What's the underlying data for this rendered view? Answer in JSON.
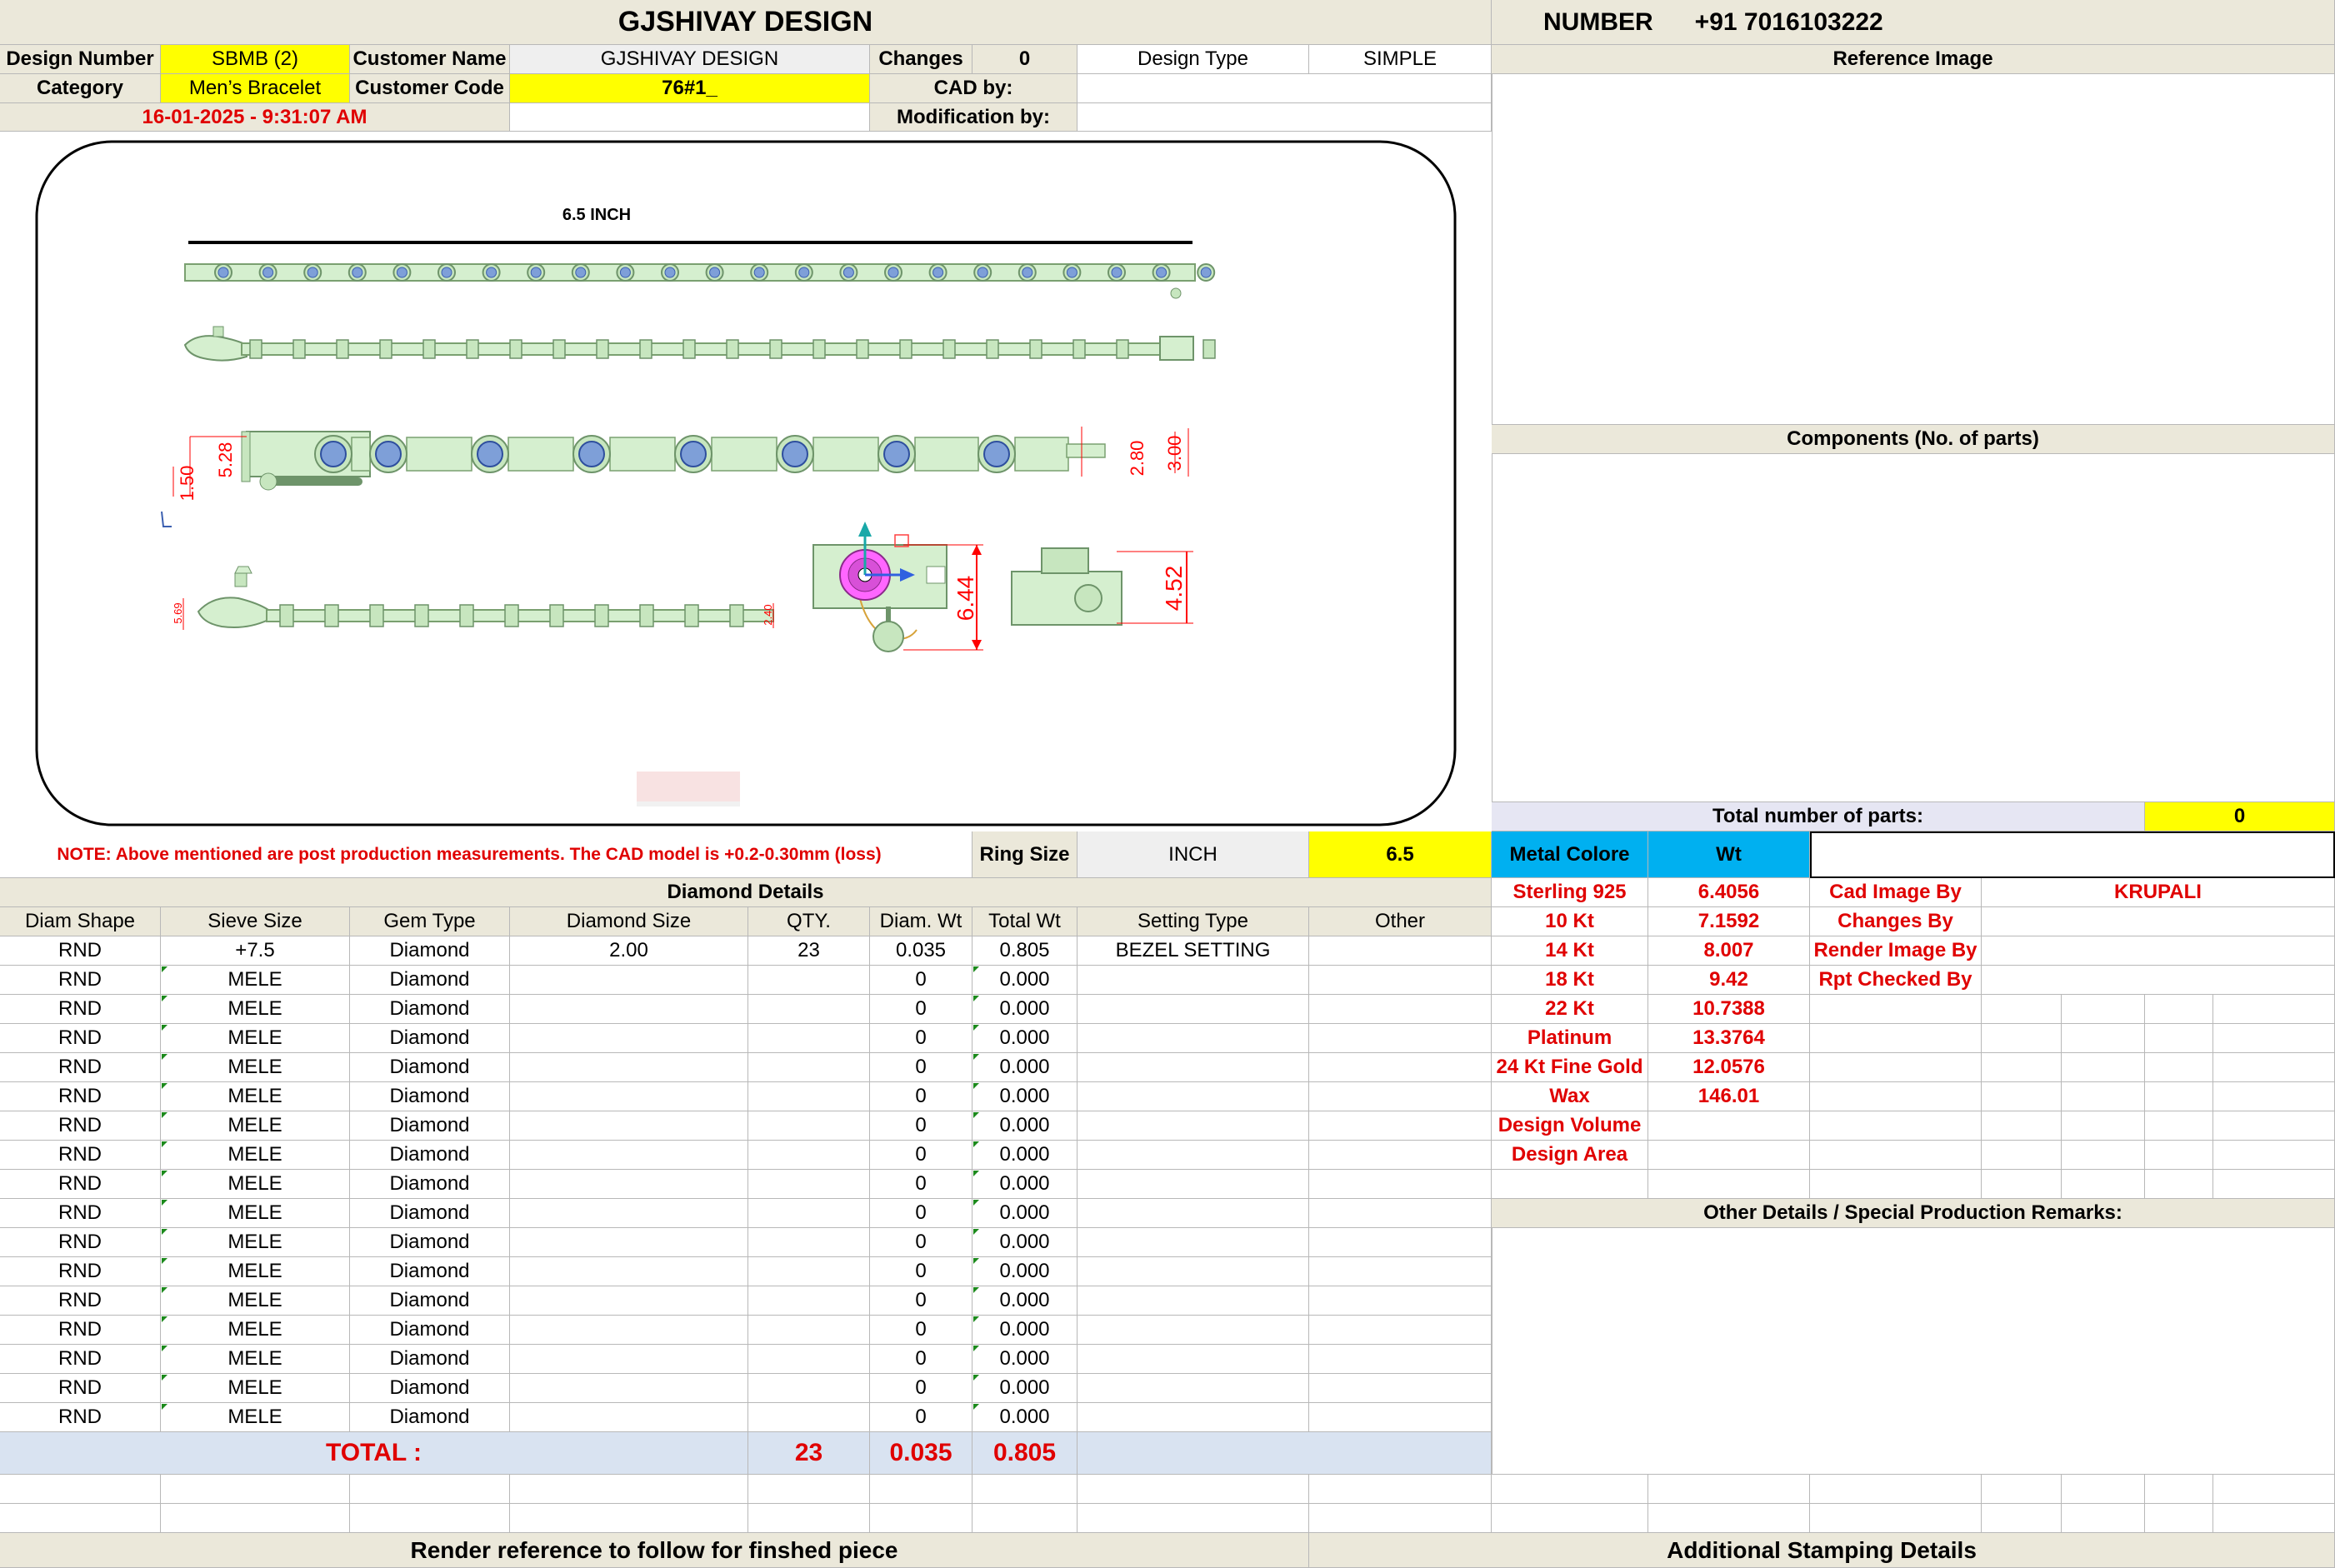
{
  "header": {
    "company": "GJSHIVAY DESIGN",
    "number_label": "NUMBER",
    "number_value": "+91 7016103222"
  },
  "info": {
    "design_number_label": "Design Number",
    "design_number": "SBMB (2)",
    "customer_name_label": "Customer Name",
    "customer_name": "GJSHIVAY DESIGN",
    "changes_label": "Changes",
    "changes": "0",
    "design_type_label": "Design Type",
    "design_type": "SIMPLE",
    "category_label": "Category",
    "category": "Men’s Bracelet",
    "customer_code_label": "Customer Code",
    "customer_code": "76#1_",
    "cad_by_label": "CAD by:",
    "cad_by": "",
    "timestamp": "16-01-2025 - 9:31:07 AM",
    "modification_by_label": "Modification by:",
    "modification_by": ""
  },
  "drawing": {
    "length_label": "6.5 INCH",
    "dims": {
      "d1": "1.50",
      "d2": "5.28",
      "d3": "2.80",
      "d4": "3.00",
      "d5": "5.69",
      "d6": "2.40",
      "d7": "6.44",
      "d8": "4.52"
    }
  },
  "right_panel": {
    "reference_image_label": "Reference Image",
    "components_label": "Components (No. of parts)",
    "total_parts_label": "Total number of parts:",
    "total_parts": "0",
    "other_details_label": "Other Details / Special Production Remarks:"
  },
  "note": "NOTE: Above mentioned are post production measurements. The CAD model is +0.2-0.30mm (loss)",
  "ring": {
    "label": "Ring Size",
    "unit": "INCH",
    "value": "6.5"
  },
  "metal": {
    "color_label": "Metal Colore",
    "wt_label": "Wt",
    "rows": [
      {
        "name": "Sterling 925",
        "wt": "6.4056"
      },
      {
        "name": "10 Kt",
        "wt": "7.1592"
      },
      {
        "name": "14 Kt",
        "wt": "8.007"
      },
      {
        "name": "18 Kt",
        "wt": "9.42"
      },
      {
        "name": "22 Kt",
        "wt": "10.7388"
      },
      {
        "name": "Platinum",
        "wt": "13.3764"
      },
      {
        "name": "24 Kt Fine Gold",
        "wt": "12.0576"
      },
      {
        "name": "Wax",
        "wt": "146.01"
      },
      {
        "name": "Design Volume",
        "wt": ""
      },
      {
        "name": "Design Area",
        "wt": ""
      }
    ]
  },
  "credits": [
    {
      "label": "Cad Image By",
      "value": "KRUPALI"
    },
    {
      "label": "Changes By",
      "value": ""
    },
    {
      "label": "Render Image By",
      "value": ""
    },
    {
      "label": "Rpt Checked By",
      "value": ""
    }
  ],
  "diamond": {
    "title": "Diamond Details",
    "columns": [
      "Diam Shape",
      "Sieve Size",
      "Gem Type",
      "Diamond Size",
      "QTY.",
      "Diam. Wt",
      "Total Wt",
      "Setting Type",
      "Other"
    ],
    "rows": [
      [
        "RND",
        "+7.5",
        "Diamond",
        "2.00",
        "23",
        "0.035",
        "0.805",
        "BEZEL SETTING",
        ""
      ],
      [
        "RND",
        "MELE",
        "Diamond",
        "",
        "",
        "0",
        "0.000",
        "",
        ""
      ],
      [
        "RND",
        "MELE",
        "Diamond",
        "",
        "",
        "0",
        "0.000",
        "",
        ""
      ],
      [
        "RND",
        "MELE",
        "Diamond",
        "",
        "",
        "0",
        "0.000",
        "",
        ""
      ],
      [
        "RND",
        "MELE",
        "Diamond",
        "",
        "",
        "0",
        "0.000",
        "",
        ""
      ],
      [
        "RND",
        "MELE",
        "Diamond",
        "",
        "",
        "0",
        "0.000",
        "",
        ""
      ],
      [
        "RND",
        "MELE",
        "Diamond",
        "",
        "",
        "0",
        "0.000",
        "",
        ""
      ],
      [
        "RND",
        "MELE",
        "Diamond",
        "",
        "",
        "0",
        "0.000",
        "",
        ""
      ],
      [
        "RND",
        "MELE",
        "Diamond",
        "",
        "",
        "0",
        "0.000",
        "",
        ""
      ],
      [
        "RND",
        "MELE",
        "Diamond",
        "",
        "",
        "0",
        "0.000",
        "",
        ""
      ],
      [
        "RND",
        "MELE",
        "Diamond",
        "",
        "",
        "0",
        "0.000",
        "",
        ""
      ],
      [
        "RND",
        "MELE",
        "Diamond",
        "",
        "",
        "0",
        "0.000",
        "",
        ""
      ],
      [
        "RND",
        "MELE",
        "Diamond",
        "",
        "",
        "0",
        "0.000",
        "",
        ""
      ],
      [
        "RND",
        "MELE",
        "Diamond",
        "",
        "",
        "0",
        "0.000",
        "",
        ""
      ],
      [
        "RND",
        "MELE",
        "Diamond",
        "",
        "",
        "0",
        "0.000",
        "",
        ""
      ],
      [
        "RND",
        "MELE",
        "Diamond",
        "",
        "",
        "0",
        "0.000",
        "",
        ""
      ],
      [
        "RND",
        "MELE",
        "Diamond",
        "",
        "",
        "0",
        "0.000",
        "",
        ""
      ]
    ],
    "total_label": "TOTAL :",
    "total_qty": "23",
    "total_diam_wt": "0.035",
    "total_wt": "0.805"
  },
  "footer": {
    "render_reference": "Render reference to follow for finshed piece",
    "additional_stamping": "Additional Stamping Details"
  },
  "colors": {
    "header_bg": "#ebe8da",
    "yellow": "#ffff00",
    "cyan": "#00b0f0",
    "total_bg": "#d9e3f1",
    "red_text": "#e00000",
    "model_fill": "#d5efcf"
  }
}
